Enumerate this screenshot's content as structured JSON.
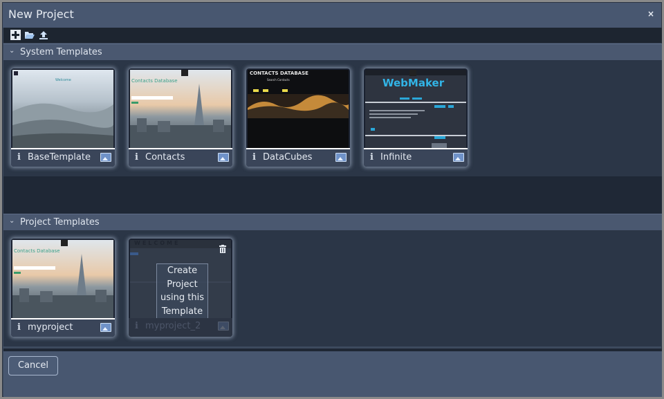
{
  "dialog": {
    "title": "New Project",
    "close_glyph": "×"
  },
  "toolbar": {
    "icons": [
      "plus-icon",
      "folder-open-icon",
      "upload-icon"
    ]
  },
  "system_templates": {
    "header": "System Templates",
    "items": [
      {
        "name": "BaseTemplate",
        "info_glyph": "i",
        "thumb_heading": "Welcome"
      },
      {
        "name": "Contacts",
        "info_glyph": "i",
        "thumb_heading": "Contacts Database"
      },
      {
        "name": "DataCubes",
        "info_glyph": "i",
        "thumb_heading": "CONTACTS DATABASE",
        "thumb_search": "Search Contacts"
      },
      {
        "name": "Infinite",
        "info_glyph": "i",
        "thumb_heading": "WebMaker"
      }
    ]
  },
  "project_templates": {
    "header": "Project Templates",
    "items": [
      {
        "name": "myproject",
        "info_glyph": "i",
        "thumb_heading": "Contacts Database"
      },
      {
        "name": "myproject_2",
        "info_glyph": "i",
        "thumb_heading": "WELCOME",
        "overlay_text": "Create Project using this Template"
      }
    ]
  },
  "footer": {
    "cancel_label": "Cancel"
  },
  "colors": {
    "accent": "#485770",
    "panel": "#2b3647",
    "card_glow": "#bccde6"
  }
}
